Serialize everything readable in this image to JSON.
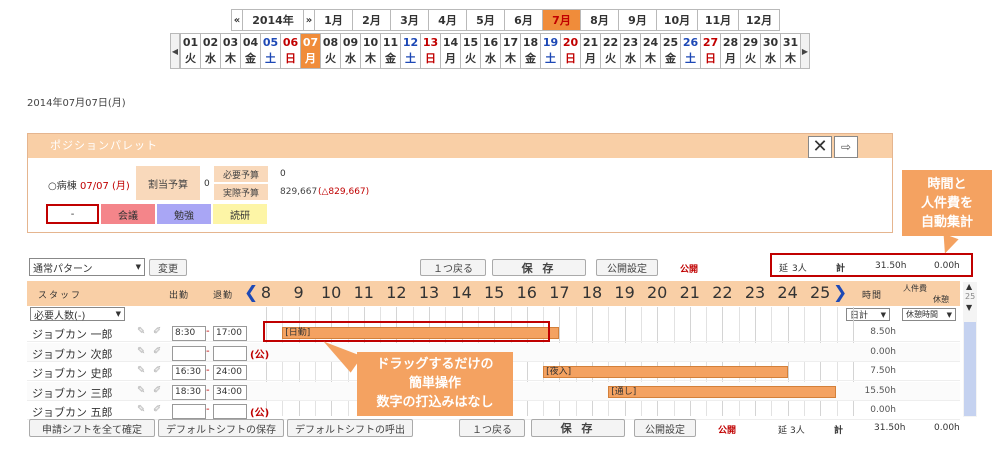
{
  "months": {
    "prev": "«",
    "year": "2014年",
    "next": "»",
    "items": [
      "1月",
      "2月",
      "3月",
      "4月",
      "5月",
      "6月",
      "7月",
      "8月",
      "9月",
      "10月",
      "11月",
      "12月"
    ],
    "selected": "7月"
  },
  "days": [
    {
      "n": "01",
      "w": "火"
    },
    {
      "n": "02",
      "w": "水"
    },
    {
      "n": "03",
      "w": "木"
    },
    {
      "n": "04",
      "w": "金"
    },
    {
      "n": "05",
      "w": "土"
    },
    {
      "n": "06",
      "w": "日"
    },
    {
      "n": "07",
      "w": "月"
    },
    {
      "n": "08",
      "w": "火"
    },
    {
      "n": "09",
      "w": "水"
    },
    {
      "n": "10",
      "w": "木"
    },
    {
      "n": "11",
      "w": "金"
    },
    {
      "n": "12",
      "w": "土"
    },
    {
      "n": "13",
      "w": "日"
    },
    {
      "n": "14",
      "w": "月"
    },
    {
      "n": "15",
      "w": "火"
    },
    {
      "n": "16",
      "w": "水"
    },
    {
      "n": "17",
      "w": "木"
    },
    {
      "n": "18",
      "w": "金"
    },
    {
      "n": "19",
      "w": "土"
    },
    {
      "n": "20",
      "w": "日"
    },
    {
      "n": "21",
      "w": "月"
    },
    {
      "n": "22",
      "w": "火"
    },
    {
      "n": "23",
      "w": "水"
    },
    {
      "n": "24",
      "w": "木"
    },
    {
      "n": "25",
      "w": "金"
    },
    {
      "n": "26",
      "w": "土"
    },
    {
      "n": "27",
      "w": "日"
    },
    {
      "n": "28",
      "w": "月"
    },
    {
      "n": "29",
      "w": "火"
    },
    {
      "n": "30",
      "w": "水"
    },
    {
      "n": "31",
      "w": "木"
    }
  ],
  "selected_day": "07",
  "date_label": "2014年07月07日(月)",
  "palette": {
    "title": "ポジションパレット",
    "ward_label": "○病棟",
    "ward_date": "07/07 (月)",
    "budget_label": "割当予算",
    "budget_value": "0",
    "required_label": "必要予算",
    "required_value": "0",
    "actual_label": "実際予算",
    "actual_value": "829,667",
    "actual_diff": "(△829,667)",
    "chips": [
      "-",
      "会議",
      "勉強",
      "読研"
    ]
  },
  "callout_top": "時間と\n人件費を\n自動集計",
  "callout_mid": "ドラッグするだけの\n簡単操作\n数字の打込みはなし",
  "toolbar": {
    "pattern": "通常パターン",
    "change": "変更",
    "undo": "１つ戻る",
    "save": "保 存",
    "publish_settings": "公開設定",
    "publish": "公開",
    "total_people_label": "延",
    "total_people": "3人",
    "total_label": "計",
    "total_hours": "31.50h",
    "total_cost": "0.00h"
  },
  "grid": {
    "staff_header": "スタッフ",
    "in_header": "出勤",
    "out_header": "退勤",
    "hours": [
      "8",
      "9",
      "10",
      "11",
      "12",
      "13",
      "14",
      "15",
      "16",
      "17",
      "18",
      "19",
      "20",
      "21",
      "22",
      "23",
      "24",
      "25"
    ],
    "time_header": "時間",
    "cost_header": "人件費",
    "break_header": "休憩",
    "required_select": "必要人数(-)",
    "daily_select": "日計",
    "break_select": "休憩時間",
    "scroll_num": "25",
    "rows": [
      {
        "name": "ジョブカン 一郎",
        "in": "8:30",
        "out": "17:00",
        "mark": "",
        "bar": "[日勤]",
        "hours": "8.50h"
      },
      {
        "name": "ジョブカン 次郎",
        "in": "",
        "out": "",
        "mark": "(公)",
        "bar": "",
        "hours": "0.00h"
      },
      {
        "name": "ジョブカン 史郎",
        "in": "16:30",
        "out": "24:00",
        "mark": "",
        "bar": "[夜入]",
        "hours": "7.50h"
      },
      {
        "name": "ジョブカン 三郎",
        "in": "18:30",
        "out": "34:00",
        "mark": "",
        "bar": "[通し]",
        "hours": "15.50h"
      },
      {
        "name": "ジョブカン 五郎",
        "in": "",
        "out": "",
        "mark": "(公)",
        "bar": "",
        "hours": "0.00h"
      }
    ]
  },
  "bottom": {
    "confirm_all": "申請シフトを全て確定",
    "save_default": "デフォルトシフトの保存",
    "load_default": "デフォルトシフトの呼出",
    "undo": "１つ戻る",
    "save": "保 存",
    "publish_settings": "公開設定",
    "publish": "公開",
    "total_people_label": "延",
    "total_people": "3人",
    "total_label": "計",
    "total_hours": "31.50h",
    "total_cost": "0.00h"
  },
  "colors": {
    "accent": "#f08c3a",
    "header": "#f9cfa6",
    "bar": "#f4a261",
    "highlight_border": "#c00000"
  }
}
